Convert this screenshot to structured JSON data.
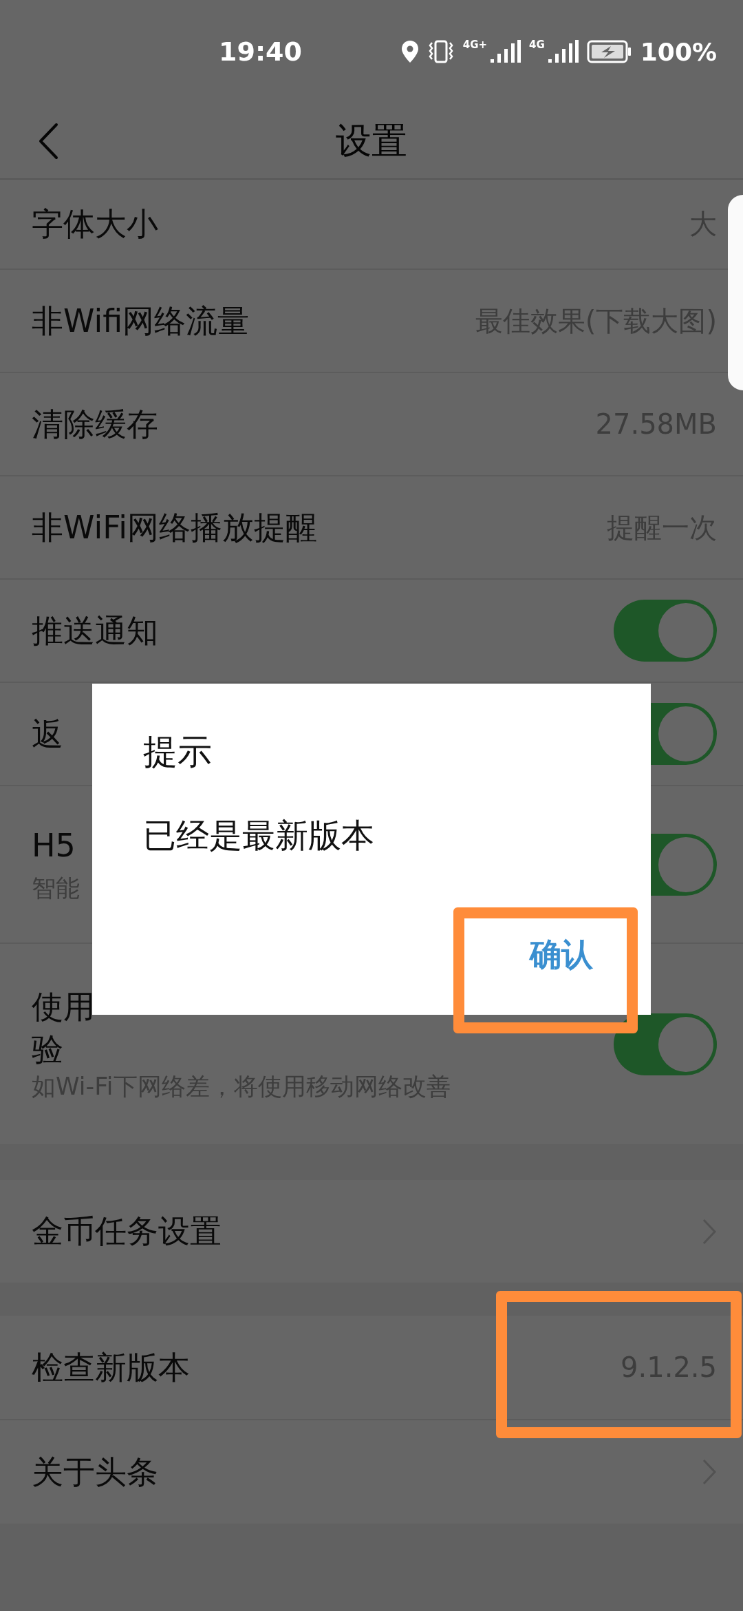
{
  "status_bar": {
    "time": "19:40",
    "network_labels": [
      "4G+",
      "4G"
    ],
    "battery": "100%"
  },
  "header": {
    "title": "设置"
  },
  "sections": [
    {
      "rows": [
        {
          "kind": "value",
          "title": "字体大小",
          "value": "大"
        },
        {
          "kind": "value",
          "title": "非Wifi网络流量",
          "value": "最佳效果(下载大图)"
        },
        {
          "kind": "value",
          "title": "清除缓存",
          "value": "27.58MB"
        },
        {
          "kind": "value",
          "title": "非WiFi网络播放提醒",
          "value": "提醒一次"
        },
        {
          "kind": "toggle",
          "title": "推送通知",
          "on": true
        },
        {
          "kind": "toggle",
          "title": "返",
          "on": true
        },
        {
          "kind": "toggle",
          "title": "H5",
          "subtitle": "智能",
          "on": true
        },
        {
          "kind": "toggle",
          "title": "使用",
          "title_continued": "验",
          "subtitle": "如Wi-Fi下网络差，将使用移动网络改善",
          "on": true
        }
      ]
    },
    {
      "rows": [
        {
          "kind": "link",
          "title": "金币任务设置"
        }
      ]
    },
    {
      "rows": [
        {
          "kind": "value",
          "title": "检查新版本",
          "value": "9.1.2.5",
          "highlighted": true
        },
        {
          "kind": "link",
          "title": "关于头条"
        }
      ]
    }
  ],
  "dialog": {
    "title": "提示",
    "message": "已经是最新版本",
    "confirm": {
      "label": "确认",
      "highlighted": true
    }
  }
}
